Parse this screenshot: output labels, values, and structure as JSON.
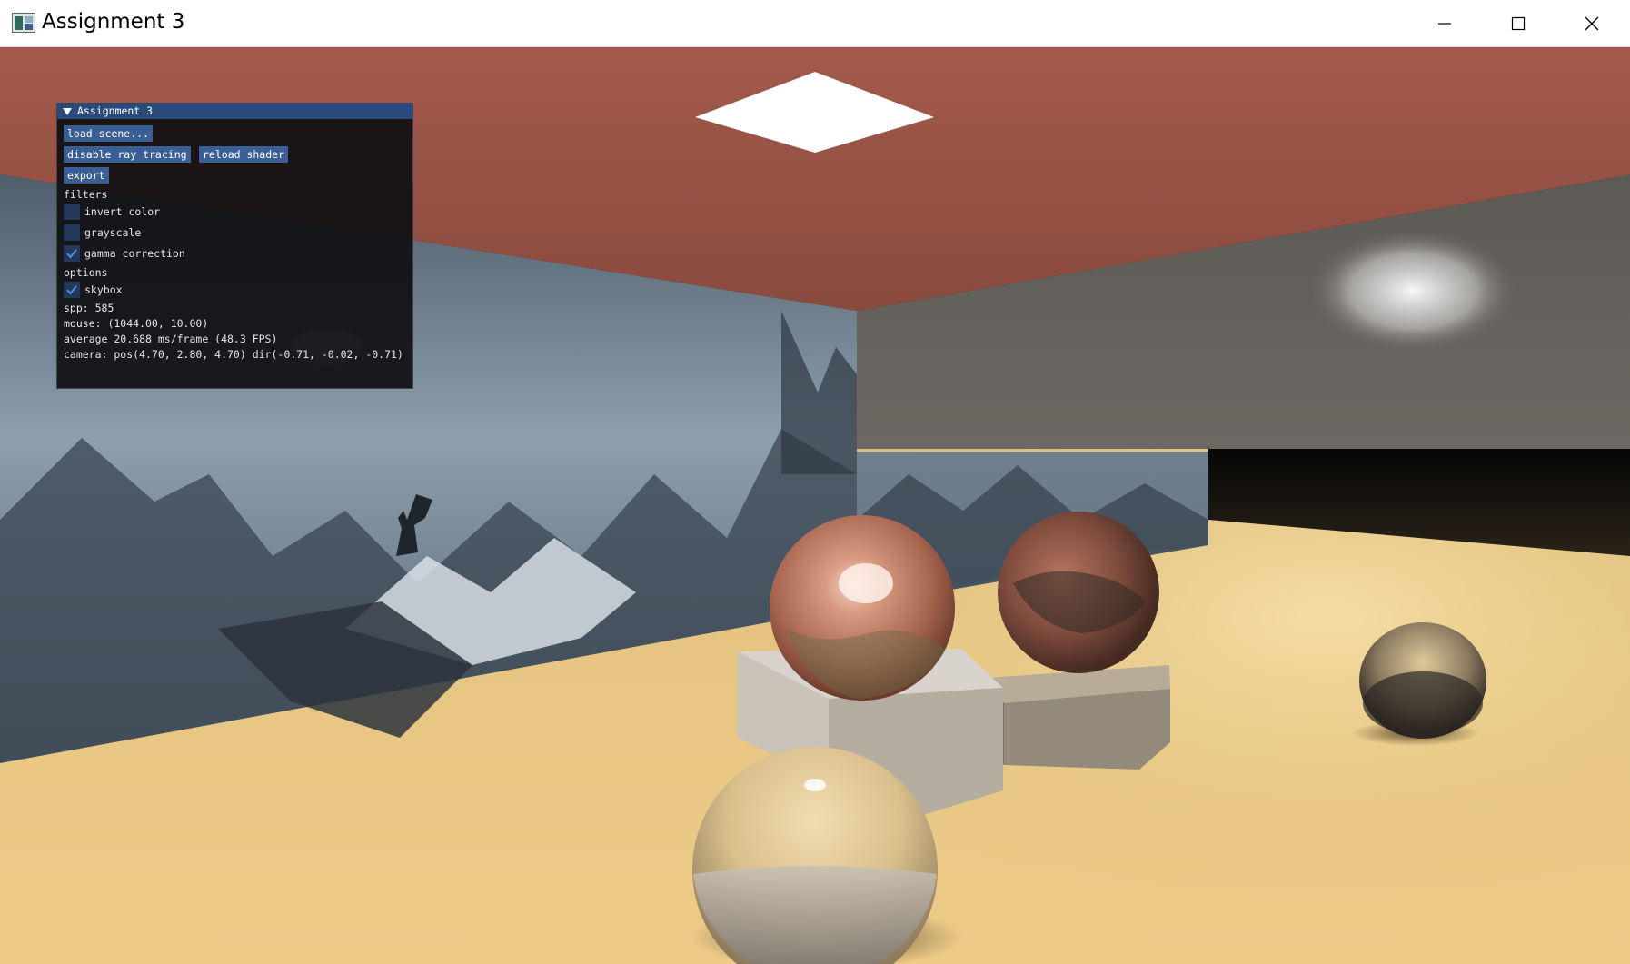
{
  "window": {
    "title": "Assignment 3",
    "icon": "app-icon",
    "controls": [
      "minimize-icon",
      "maximize-icon",
      "close-icon"
    ]
  },
  "panel": {
    "title": "Assignment 3",
    "buttons": {
      "load_scene": "load scene...",
      "disable_ray_tracing": "disable ray tracing",
      "reload_shader": "reload shader",
      "export": "export"
    },
    "filters": {
      "heading": "filters",
      "invert_color": {
        "label": "invert color",
        "checked": false
      },
      "grayscale": {
        "label": "grayscale",
        "checked": false
      },
      "gamma_correction": {
        "label": "gamma correction",
        "checked": true
      }
    },
    "options": {
      "heading": "options",
      "skybox": {
        "label": "skybox",
        "checked": true
      }
    },
    "stats": {
      "spp": "spp: 585",
      "mouse": "mouse: (1044.00, 10.00)",
      "average": "average 20.688 ms/frame (48.3 FPS)",
      "camera": "camera: pos(4.70, 2.80, 4.70) dir(-0.71, -0.02, -0.71)"
    }
  },
  "colors": {
    "panel_bg": "#0f0f11",
    "header": "#294a7a",
    "button": "#3a5f95",
    "checkbox": "#23385a",
    "check_mark": "#4d8fe6",
    "ceiling": "#9a5346",
    "floor": "#e3c07e",
    "back_wall": "#5a5753"
  }
}
